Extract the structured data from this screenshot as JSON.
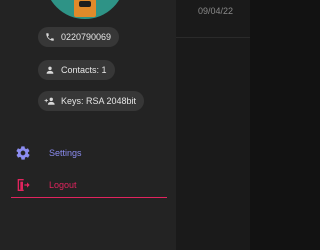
{
  "main": {
    "date": "09/04/22"
  },
  "profile": {
    "phone": "0220790069",
    "contacts": "Contacts: 1",
    "keys": "Keys: RSA 2048bit"
  },
  "menu": {
    "settings_label": "Settings",
    "logout_label": "Logout"
  },
  "icons": {
    "phone": "phone-icon",
    "contacts": "person-icon",
    "keys": "key-person-icon",
    "settings": "gear-icon",
    "logout": "logout-icon"
  },
  "colors": {
    "accent_settings": "#8b8cf0",
    "accent_logout": "#e1245e",
    "chip_bg": "#373737",
    "drawer_bg": "#232323",
    "background": "#121212"
  }
}
